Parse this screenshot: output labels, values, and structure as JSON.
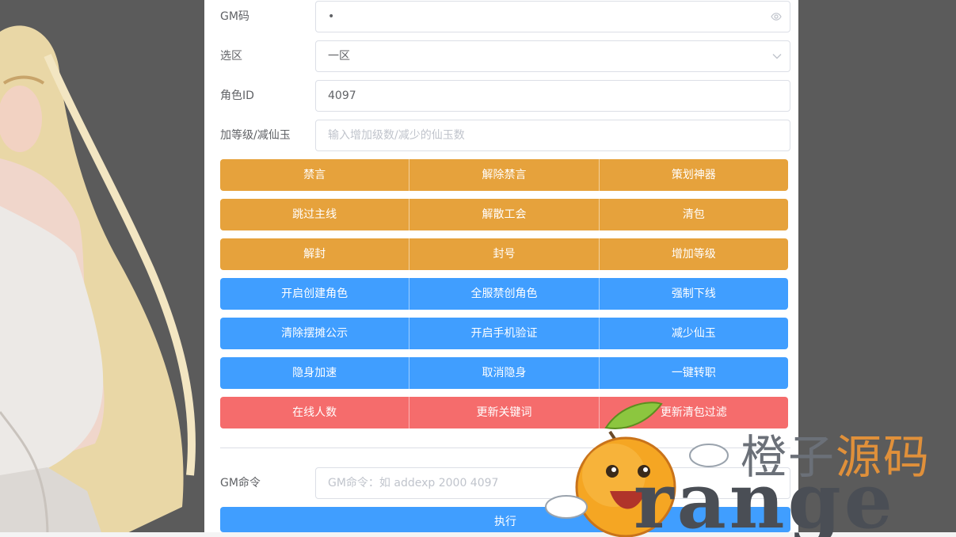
{
  "form": {
    "gm_code": {
      "label": "GM码",
      "value": "•"
    },
    "zone": {
      "label": "选区",
      "value": "一区"
    },
    "role_id": {
      "label": "角色ID",
      "value": "4097"
    },
    "level": {
      "label": "加等级/减仙玉",
      "placeholder": "输入增加级数/减少的仙玉数"
    }
  },
  "button_rows": [
    {
      "color": "#e6a23c",
      "buttons": [
        "禁言",
        "解除禁言",
        "策划神器"
      ]
    },
    {
      "color": "#e6a23c",
      "buttons": [
        "跳过主线",
        "解散工会",
        "清包"
      ]
    },
    {
      "color": "#e6a23c",
      "buttons": [
        "解封",
        "封号",
        "增加等级"
      ]
    },
    {
      "color": "#409eff",
      "buttons": [
        "开启创建角色",
        "全服禁创角色",
        "强制下线"
      ]
    },
    {
      "color": "#409eff",
      "buttons": [
        "清除摆摊公示",
        "开启手机验证",
        "减少仙玉"
      ]
    },
    {
      "color": "#409eff",
      "buttons": [
        "隐身加速",
        "取消隐身",
        "一键转职"
      ]
    },
    {
      "color": "#f56c6c",
      "buttons": [
        "在线人数",
        "更新关键词",
        "更新清包过滤"
      ]
    }
  ],
  "command": {
    "label": "GM命令",
    "placeholder": "GM命令：如 addexp 2000 4097",
    "execute_label": "执行"
  },
  "watermark": {
    "cn_part1": "橙子",
    "cn_part2": "源码",
    "latin": "range"
  },
  "icons": {
    "password_toggle": "eye-icon",
    "dropdown": "chevron-down-icon"
  }
}
